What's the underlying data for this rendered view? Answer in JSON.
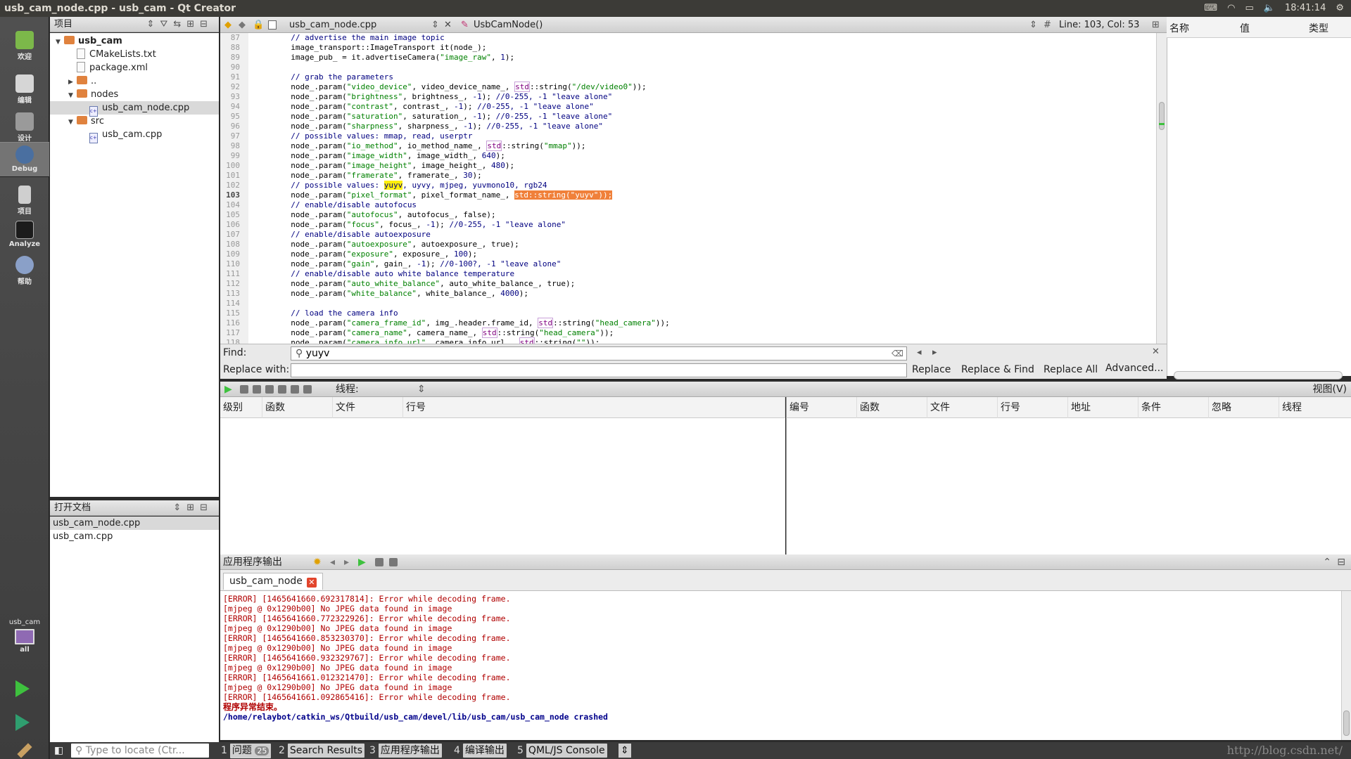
{
  "window": {
    "title": "usb_cam_node.cpp - usb_cam - Qt Creator",
    "time": "18:41:14"
  },
  "modes": [
    {
      "label": "欢迎",
      "icon": "welcome-icon"
    },
    {
      "label": "编辑",
      "icon": "edit-icon"
    },
    {
      "label": "设计",
      "icon": "design-icon"
    },
    {
      "label": "Debug",
      "icon": "debug-icon"
    },
    {
      "label": "项目",
      "icon": "projects-icon"
    },
    {
      "label": "Analyze",
      "icon": "analyze-icon"
    },
    {
      "label": "帮助",
      "icon": "help-icon"
    }
  ],
  "target": {
    "project": "usb_cam",
    "config": "all"
  },
  "projects_panel": {
    "title": "项目",
    "tree": [
      {
        "label": "usb_cam",
        "type": "folder",
        "depth": 0,
        "expanded": true,
        "bold": true
      },
      {
        "label": "CMakeLists.txt",
        "type": "file",
        "depth": 1
      },
      {
        "label": "package.xml",
        "type": "file",
        "depth": 1
      },
      {
        "label": "..",
        "type": "folder",
        "depth": 1,
        "expanded": false
      },
      {
        "label": "nodes",
        "type": "folder",
        "depth": 1,
        "expanded": true
      },
      {
        "label": "usb_cam_node.cpp",
        "type": "cpp",
        "depth": 2,
        "selected": true
      },
      {
        "label": "src",
        "type": "folder",
        "depth": 1,
        "expanded": true
      },
      {
        "label": "usb_cam.cpp",
        "type": "cpp",
        "depth": 2
      }
    ]
  },
  "open_docs": {
    "title": "打开文档",
    "items": [
      "usb_cam_node.cpp",
      "usb_cam.cpp"
    ]
  },
  "editor": {
    "file": "usb_cam_node.cpp",
    "symbol": "UsbCamNode()",
    "position": "Line: 103, Col: 53",
    "current_line": 103,
    "lines": [
      {
        "n": 87,
        "t": "  // advertise the main image topic"
      },
      {
        "n": 88,
        "t": "  image_transport::ImageTransport it(node_);"
      },
      {
        "n": 89,
        "t": "  image_pub_ = it.advertiseCamera(\"image_raw\", 1);"
      },
      {
        "n": 90,
        "t": ""
      },
      {
        "n": 91,
        "t": "  // grab the parameters"
      },
      {
        "n": 92,
        "t": "  node_.param(\"video_device\", video_device_name_, std::string(\"/dev/video0\"));"
      },
      {
        "n": 93,
        "t": "  node_.param(\"brightness\", brightness_, -1); //0-255, -1 \"leave alone\""
      },
      {
        "n": 94,
        "t": "  node_.param(\"contrast\", contrast_, -1); //0-255, -1 \"leave alone\""
      },
      {
        "n": 95,
        "t": "  node_.param(\"saturation\", saturation_, -1); //0-255, -1 \"leave alone\""
      },
      {
        "n": 96,
        "t": "  node_.param(\"sharpness\", sharpness_, -1); //0-255, -1 \"leave alone\""
      },
      {
        "n": 97,
        "t": "  // possible values: mmap, read, userptr"
      },
      {
        "n": 98,
        "t": "  node_.param(\"io_method\", io_method_name_, std::string(\"mmap\"));"
      },
      {
        "n": 99,
        "t": "  node_.param(\"image_width\", image_width_, 640);"
      },
      {
        "n": 100,
        "t": "  node_.param(\"image_height\", image_height_, 480);"
      },
      {
        "n": 101,
        "t": "  node_.param(\"framerate\", framerate_, 30);"
      },
      {
        "n": 102,
        "t": "  // possible values: yuyv, uyvy, mjpeg, yuvmono10, rgb24"
      },
      {
        "n": 103,
        "t": "  node_.param(\"pixel_format\", pixel_format_name_, std::string(\"yuyv\"));"
      },
      {
        "n": 104,
        "t": "  // enable/disable autofocus"
      },
      {
        "n": 105,
        "t": "  node_.param(\"autofocus\", autofocus_, false);"
      },
      {
        "n": 106,
        "t": "  node_.param(\"focus\", focus_, -1); //0-255, -1 \"leave alone\""
      },
      {
        "n": 107,
        "t": "  // enable/disable autoexposure"
      },
      {
        "n": 108,
        "t": "  node_.param(\"autoexposure\", autoexposure_, true);"
      },
      {
        "n": 109,
        "t": "  node_.param(\"exposure\", exposure_, 100);"
      },
      {
        "n": 110,
        "t": "  node_.param(\"gain\", gain_, -1); //0-100?, -1 \"leave alone\""
      },
      {
        "n": 111,
        "t": "  // enable/disable auto white balance temperature"
      },
      {
        "n": 112,
        "t": "  node_.param(\"auto_white_balance\", auto_white_balance_, true);"
      },
      {
        "n": 113,
        "t": "  node_.param(\"white_balance\", white_balance_, 4000);"
      },
      {
        "n": 114,
        "t": ""
      },
      {
        "n": 115,
        "t": "  // load the camera info"
      },
      {
        "n": 116,
        "t": "  node_.param(\"camera_frame_id\", img_.header.frame_id, std::string(\"head_camera\"));"
      },
      {
        "n": 117,
        "t": "  node_.param(\"camera_name\", camera_name_, std::string(\"head_camera\"));"
      },
      {
        "n": 118,
        "t": "  node_.param(\"camera_info_url\", camera_info_url_, std::string(\"\"));"
      }
    ]
  },
  "find": {
    "find_label": "Find:",
    "find_value": "yuyv",
    "replace_label": "Replace with:",
    "replace_value": "",
    "replace_btn": "Replace",
    "replace_find_btn": "Replace & Find",
    "replace_all_btn": "Replace All",
    "advanced_btn": "Advanced..."
  },
  "locals": {
    "columns": [
      "名称",
      "值",
      "类型"
    ]
  },
  "debugger": {
    "thread_label": "线程:",
    "view_label": "视图(V)",
    "stack_columns": [
      "级别",
      "函数",
      "文件",
      "行号"
    ],
    "breakpoint_columns": [
      "编号",
      "函数",
      "文件",
      "行号",
      "地址",
      "条件",
      "忽略",
      "线程"
    ]
  },
  "output": {
    "title": "应用程序输出",
    "tab": "usb_cam_node",
    "lines": [
      {
        "k": "err",
        "t": "[ERROR] [1465641660.692317814]: Error while decoding frame."
      },
      {
        "k": "err",
        "t": "[mjpeg @ 0x1290b00] No JPEG data found in image"
      },
      {
        "k": "err",
        "t": "[ERROR] [1465641660.772322926]: Error while decoding frame."
      },
      {
        "k": "err",
        "t": "[mjpeg @ 0x1290b00] No JPEG data found in image"
      },
      {
        "k": "err",
        "t": "[ERROR] [1465641660.853230370]: Error while decoding frame."
      },
      {
        "k": "err",
        "t": "[mjpeg @ 0x1290b00] No JPEG data found in image"
      },
      {
        "k": "err",
        "t": "[ERROR] [1465641660.932329767]: Error while decoding frame."
      },
      {
        "k": "err",
        "t": "[mjpeg @ 0x1290b00] No JPEG data found in image"
      },
      {
        "k": "err",
        "t": "[ERROR] [1465641661.012321470]: Error while decoding frame."
      },
      {
        "k": "err",
        "t": "[mjpeg @ 0x1290b00] No JPEG data found in image"
      },
      {
        "k": "err",
        "t": "[ERROR] [1465641661.092865416]: Error while decoding frame."
      },
      {
        "k": "crash",
        "t": "程序异常结束。"
      },
      {
        "k": "path",
        "t": "/home/relaybot/catkin_ws/Qtbuild/usb_cam/devel/lib/usb_cam/usb_cam_node crashed"
      }
    ]
  },
  "statusbar": {
    "locator_placeholder": "Type to locate (Ctr...",
    "items": [
      {
        "num": "1",
        "label": "问题",
        "badge": "25"
      },
      {
        "num": "2",
        "label": "Search Results"
      },
      {
        "num": "3",
        "label": "应用程序输出"
      },
      {
        "num": "4",
        "label": "编译输出"
      },
      {
        "num": "5",
        "label": "QML/JS Console"
      }
    ],
    "watermark": "http://blog.csdn.net/"
  }
}
